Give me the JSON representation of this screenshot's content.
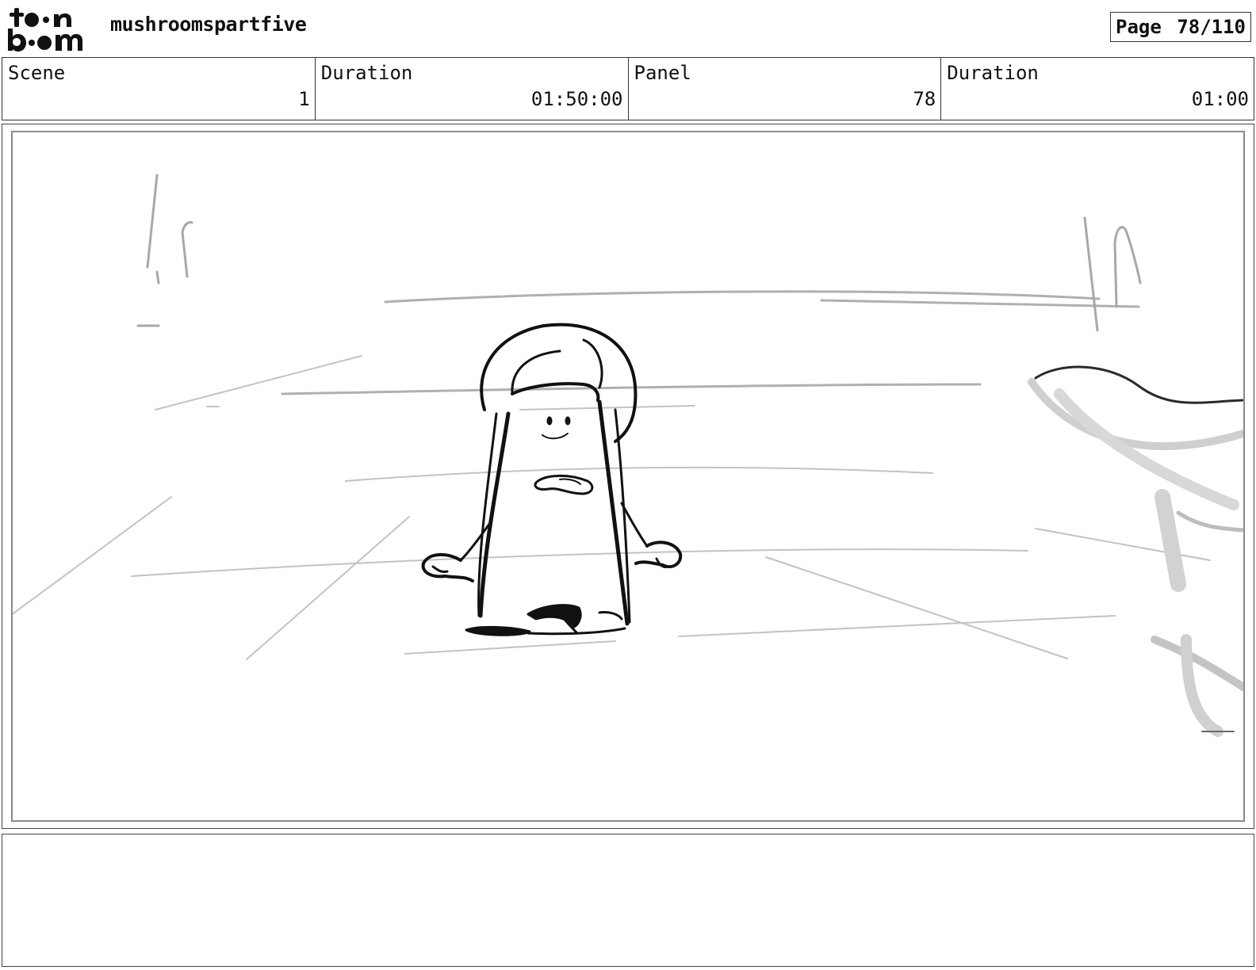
{
  "header": {
    "logo_text": "toon boom",
    "project_title": "mushroomspartfive",
    "page_label": "Page",
    "page_value": "78/110"
  },
  "info": {
    "scene_label": "Scene",
    "scene_value": "1",
    "scene_duration_label": "Duration",
    "scene_duration_value": "01:50:00",
    "panel_label": "Panel",
    "panel_value": "78",
    "panel_duration_label": "Duration",
    "panel_duration_value": "01:00"
  },
  "notes": {
    "text": ""
  }
}
